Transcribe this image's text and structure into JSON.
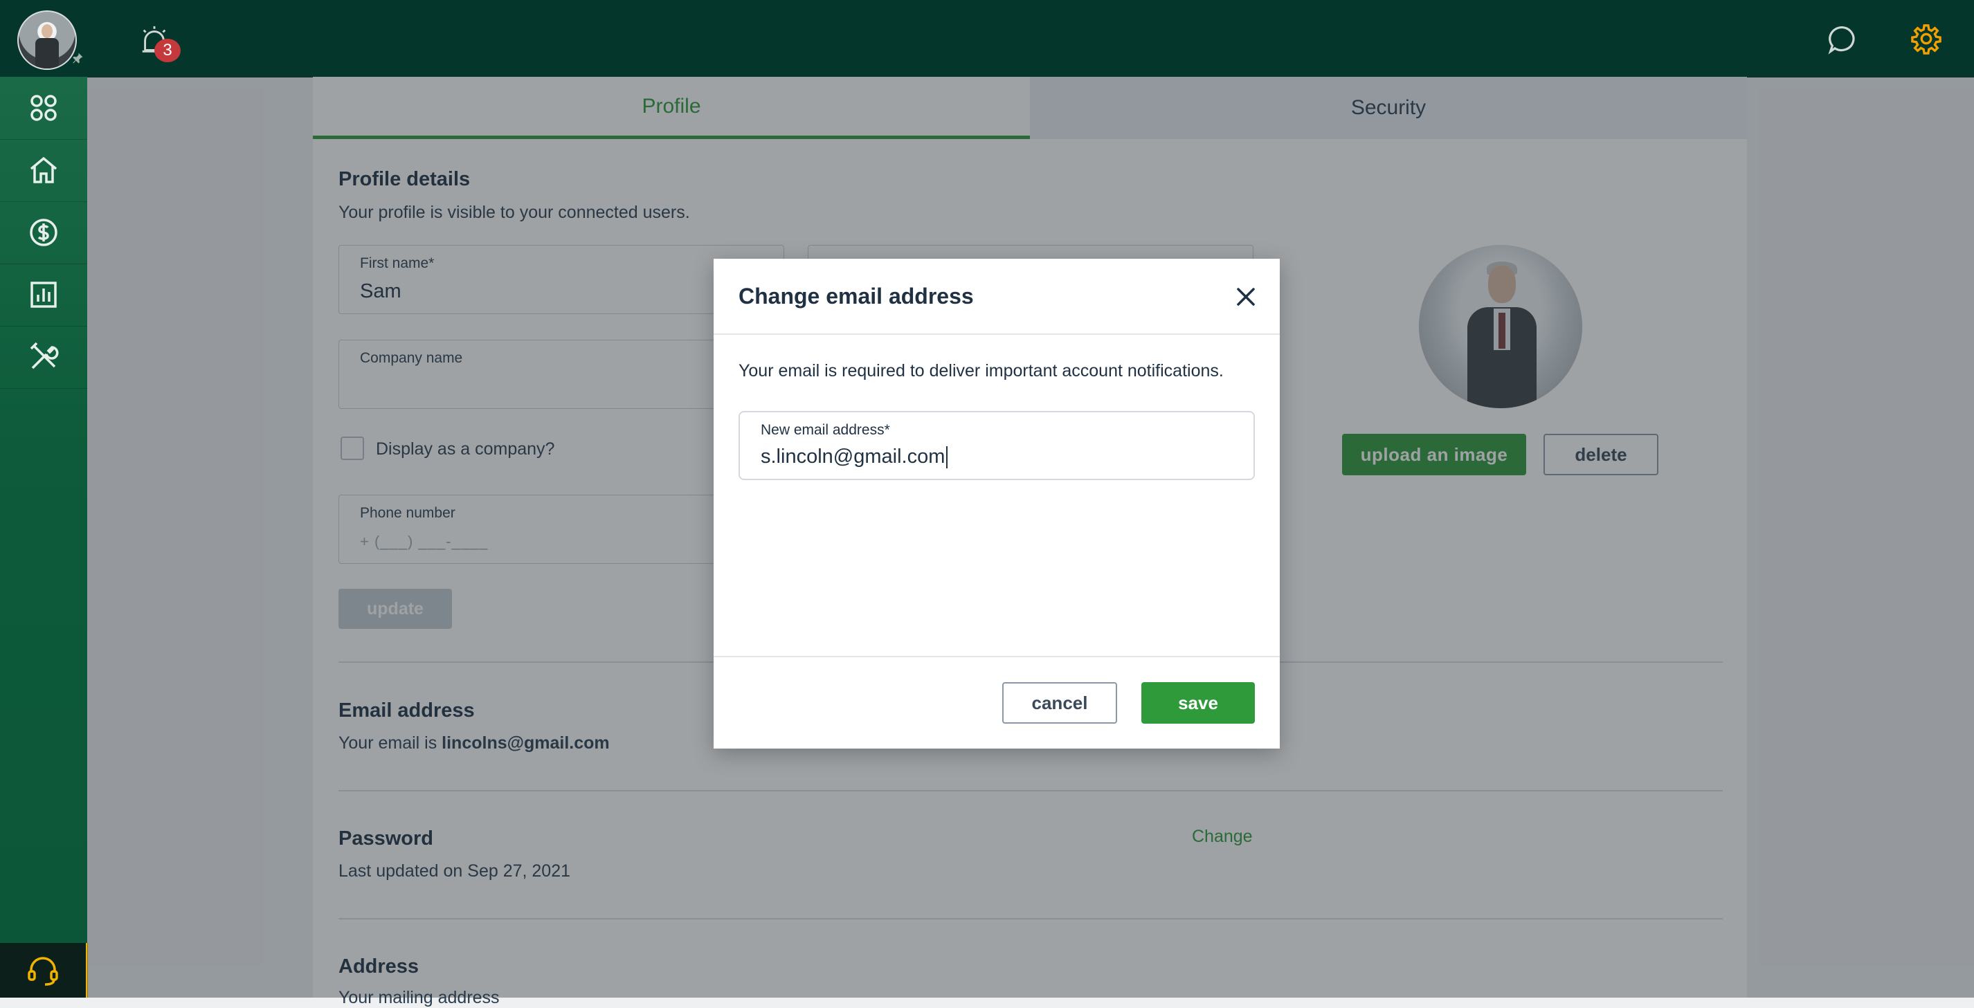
{
  "topbar": {
    "notification_count": "3",
    "icons": [
      "avatar",
      "pin-icon",
      "alarm-icon",
      "chat-icon",
      "gear-icon"
    ]
  },
  "sidebar": {
    "items": [
      {
        "icon": "apps-grid-icon"
      },
      {
        "icon": "home-icon"
      },
      {
        "icon": "dollar-icon"
      },
      {
        "icon": "bar-chart-icon"
      },
      {
        "icon": "tools-icon"
      }
    ],
    "support_icon": "headset-icon"
  },
  "tabs": {
    "profile": "Profile",
    "security": "Security"
  },
  "profile": {
    "title": "Profile details",
    "subtitle": "Your profile is visible to your connected users.",
    "first_name_label": "First name*",
    "first_name_value": "Sam",
    "company_label": "Company name",
    "company_value": "",
    "display_company_label": "Display as a company?",
    "phone_label": "Phone number",
    "phone_mask": "+ (___) ___-____",
    "update_label": "update",
    "upload_label": "upload an image",
    "delete_label": "delete"
  },
  "email_section": {
    "title": "Email address",
    "prefix": "Your email is",
    "email": "lincolns@gmail.com"
  },
  "password_section": {
    "title": "Password",
    "updated": "Last updated on Sep 27, 2021",
    "change_label": "Change"
  },
  "address_section": {
    "title": "Address",
    "subtitle": "Your mailing address"
  },
  "modal": {
    "title": "Change email address",
    "description": "Your email is required to deliver important account notifications.",
    "field_label": "New email address*",
    "field_value": "s.lincoln@gmail.com",
    "cancel_label": "cancel",
    "save_label": "save"
  },
  "colors": {
    "topbar": "#05362b",
    "sidebar": "#0d5b3a",
    "accent": "#2f9a3a",
    "support_accent": "#f0b400",
    "badge": "#c5383b"
  }
}
